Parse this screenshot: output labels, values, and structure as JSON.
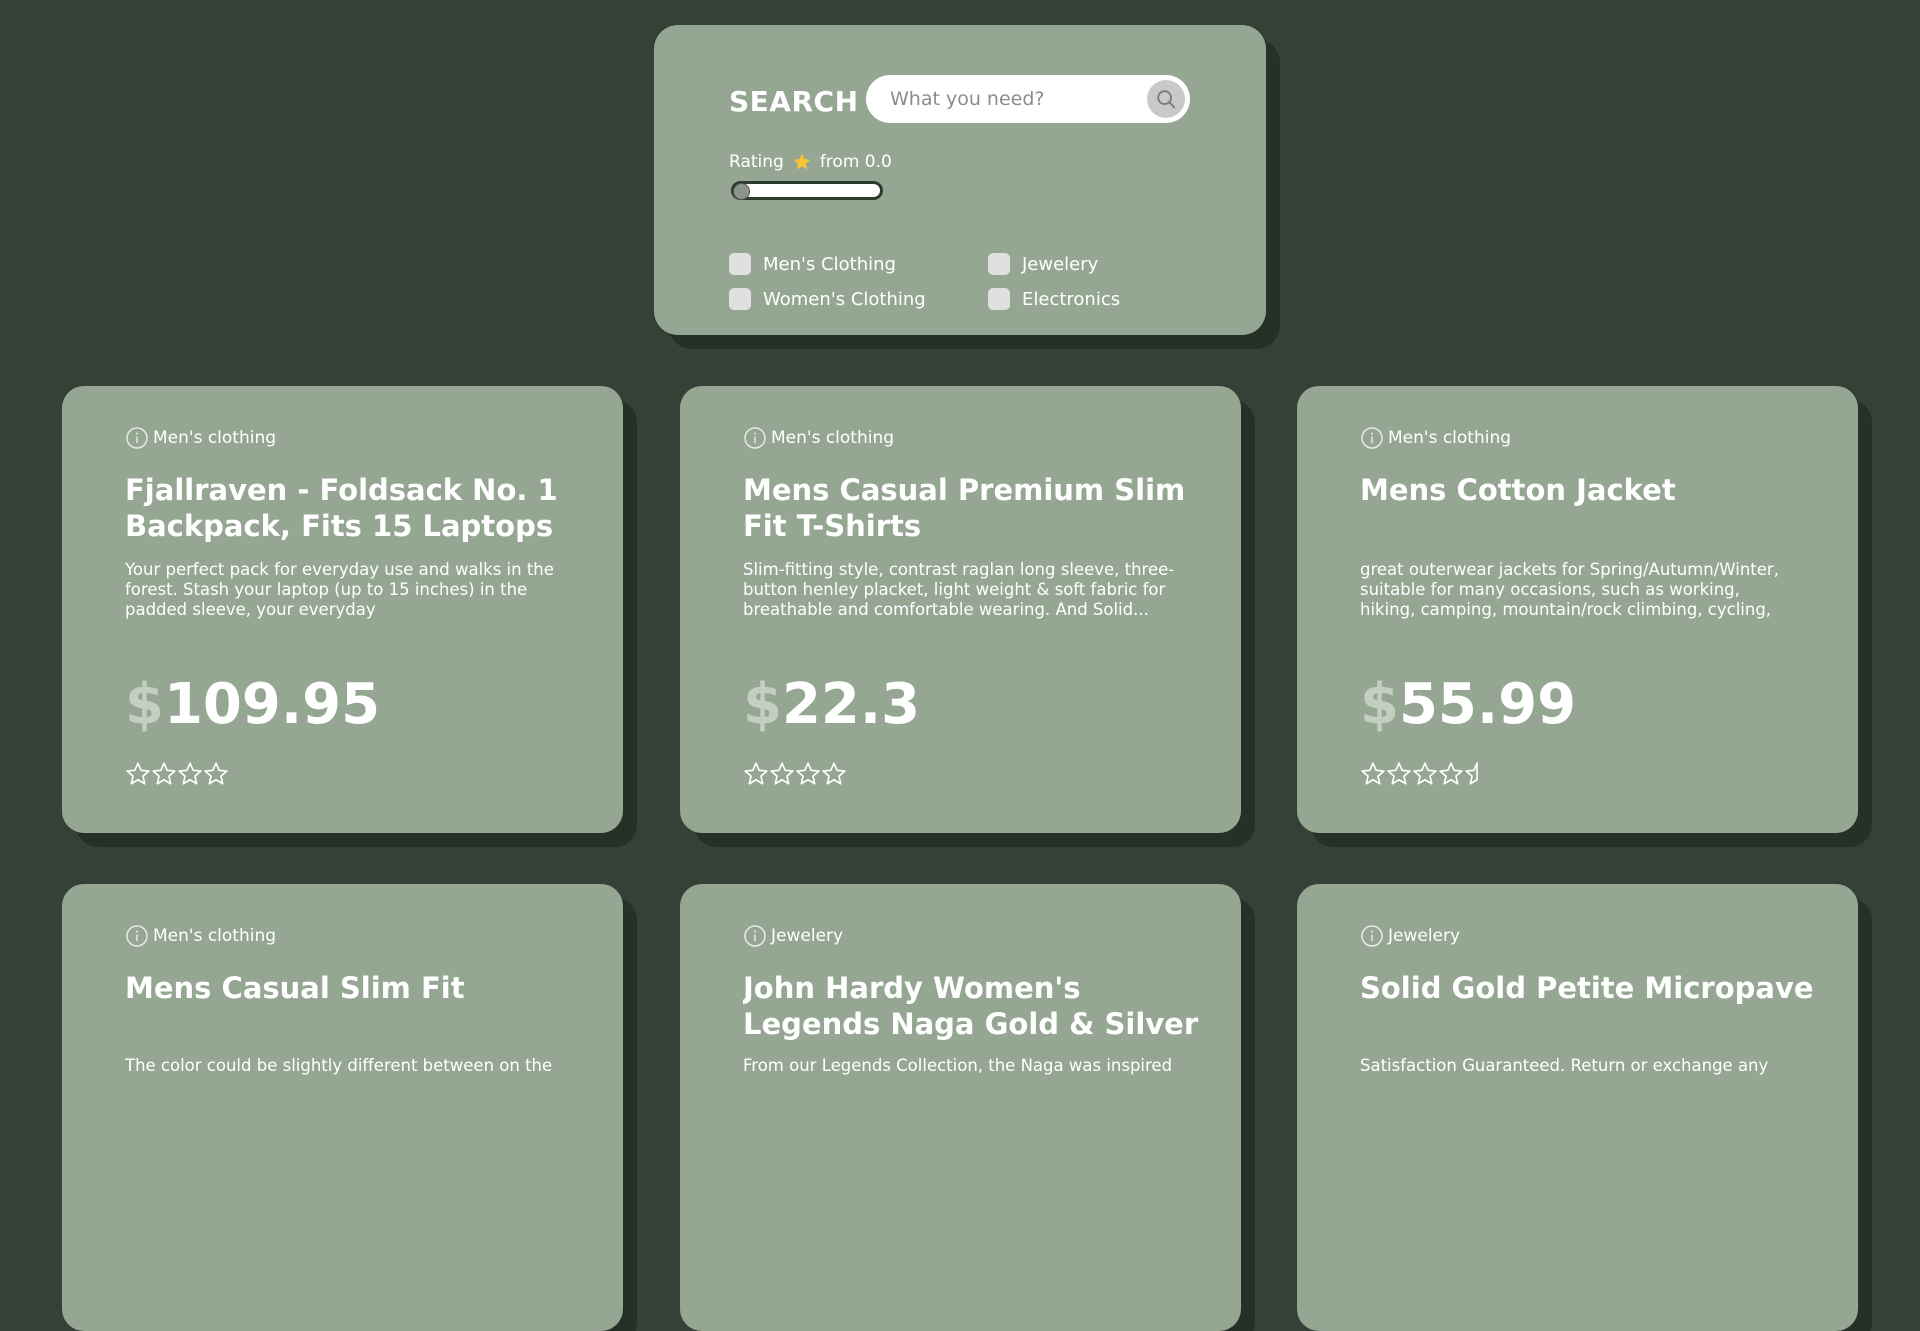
{
  "search": {
    "title": "SEARCH",
    "placeholder": "What you need?",
    "rating_label": "Rating",
    "rating_from": "from 0.0",
    "rating_value": 0.0,
    "filters": [
      {
        "label": "Men's Clothing",
        "checked": false
      },
      {
        "label": "Jewelery",
        "checked": false
      },
      {
        "label": "Women's Clothing",
        "checked": false
      },
      {
        "label": "Electronics",
        "checked": false
      }
    ]
  },
  "products": [
    {
      "category": "Men's clothing",
      "title": "Fjallraven - Foldsack No. 1 Backpack, Fits 15 Laptops",
      "description": "Your perfect pack for everyday use and walks in the forest. Stash your laptop (up to 15 inches) in the padded sleeve, your everyday",
      "currency": "$",
      "price": "109.95",
      "stars": 4
    },
    {
      "category": "Men's clothing",
      "title": "Mens Casual Premium Slim Fit T-Shirts",
      "description": "Slim-fitting style, contrast raglan long sleeve, three-button henley placket, light weight & soft fabric for breathable and comfortable wearing. And Solid...",
      "currency": "$",
      "price": "22.3",
      "stars": 4
    },
    {
      "category": "Men's clothing",
      "title": "Mens Cotton Jacket",
      "description": "great outerwear jackets for Spring/Autumn/Winter, suitable for many occasions, such as working, hiking, camping, mountain/rock climbing, cycling, traveling ...",
      "currency": "$",
      "price": "55.99",
      "stars": 4.5
    },
    {
      "category": "Men's clothing",
      "title": "Mens Casual Slim Fit",
      "description": "The color could be slightly different between on the",
      "currency": "$",
      "price": "",
      "stars": 0
    },
    {
      "category": "Jewelery",
      "title": "John Hardy Women's Legends Naga Gold & Silver Dragon...",
      "description": "From our Legends Collection, the Naga was inspired",
      "currency": "$",
      "price": "",
      "stars": 0
    },
    {
      "category": "Jewelery",
      "title": "Solid Gold Petite Micropave",
      "description": "Satisfaction Guaranteed. Return or exchange any",
      "currency": "$",
      "price": "",
      "stars": 0
    }
  ],
  "colors": {
    "background": "#354036",
    "card": "#95a793",
    "shadow": "#263027",
    "star_rating_icon": "#f7c531"
  }
}
